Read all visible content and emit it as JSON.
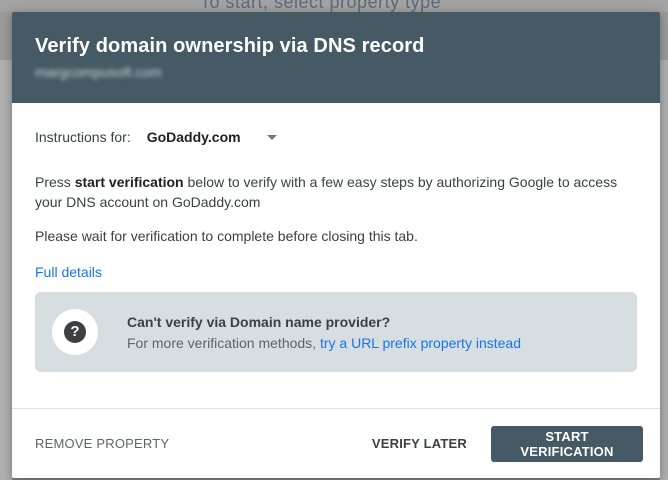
{
  "background": {
    "title": "To start, select property type"
  },
  "dialog": {
    "title": "Verify domain ownership via DNS record",
    "domain": "margcompusoft.com",
    "instructions_label": "Instructions for:",
    "provider": "GoDaddy.com",
    "para1_prefix": "Press ",
    "para1_bold": "start verification",
    "para1_suffix": " below to verify with a few easy steps by authorizing Google to access your DNS account on GoDaddy.com",
    "para2": "Please wait for verification to complete before closing this tab.",
    "full_details": "Full details",
    "callout": {
      "title": "Can't verify via Domain name provider?",
      "sub_prefix": "For more verification methods, ",
      "sub_link": "try a URL prefix property instead",
      "icon": "?"
    },
    "footer": {
      "remove": "REMOVE PROPERTY",
      "later": "VERIFY LATER",
      "start": "START VERIFICATION"
    }
  },
  "colors": {
    "header": "#455a64",
    "link": "#1a73e8",
    "callout_bg": "#d7dee2"
  }
}
